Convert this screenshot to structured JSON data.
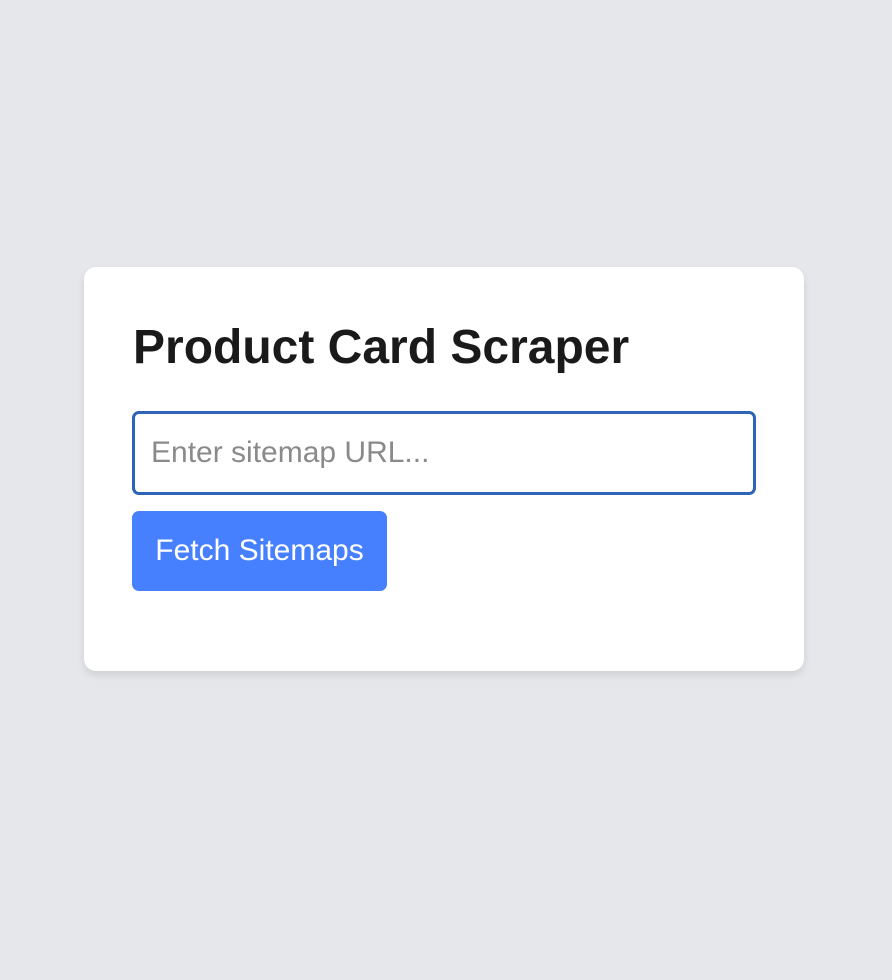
{
  "card": {
    "title": "Product Card Scraper",
    "url_input": {
      "value": "",
      "placeholder": "Enter sitemap URL..."
    },
    "fetch_button_label": "Fetch Sitemaps"
  },
  "colors": {
    "background": "#e5e7eb",
    "card": "#ffffff",
    "input_border": "#2f63b8",
    "button": "#4780ff",
    "button_text": "#ffffff",
    "title_text": "#1a1a1a",
    "placeholder_text": "#8a8a8a"
  }
}
